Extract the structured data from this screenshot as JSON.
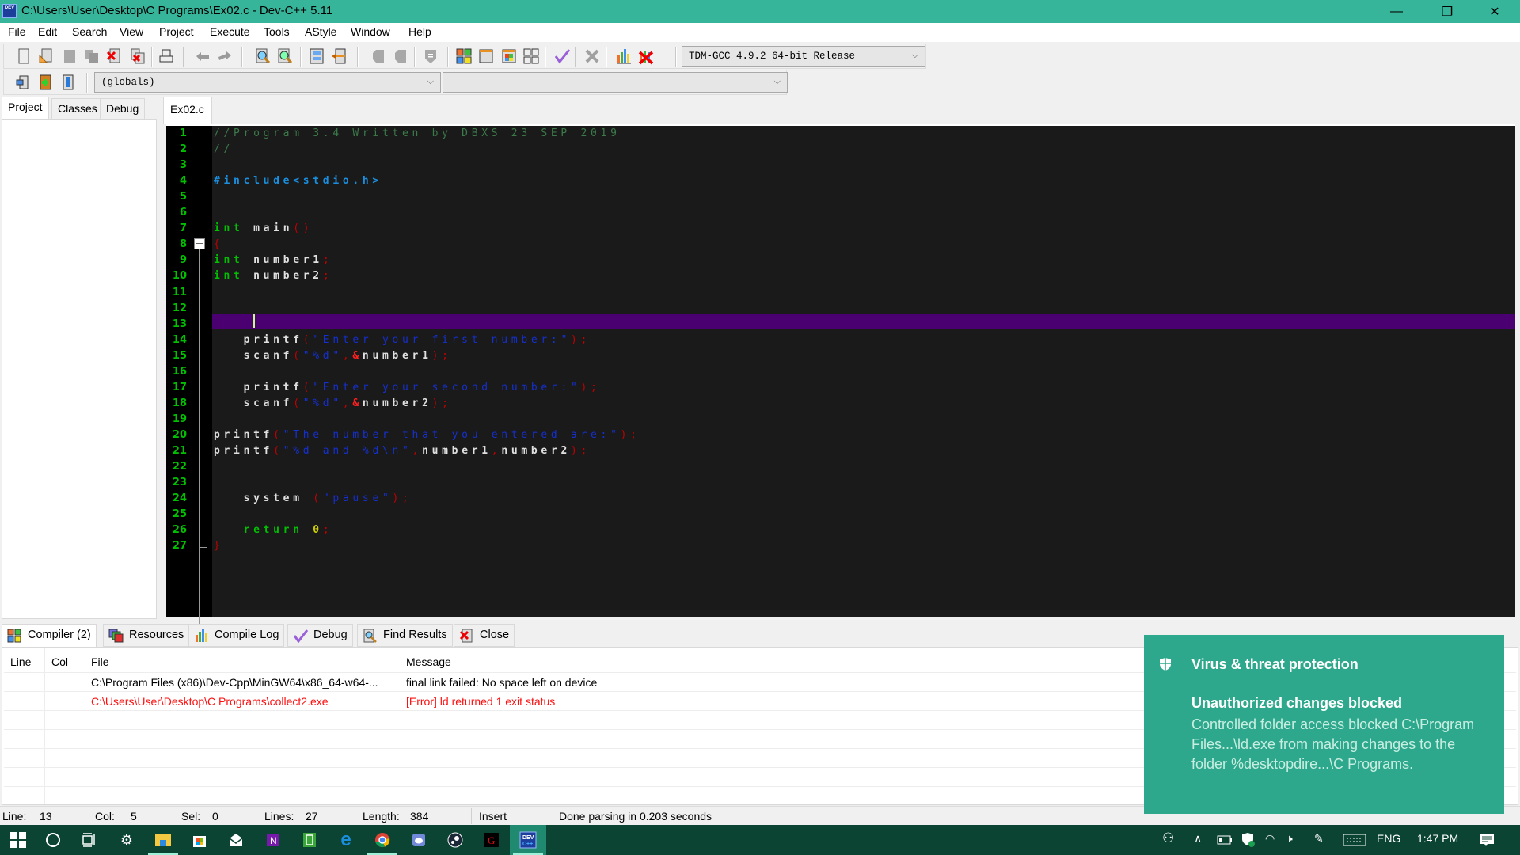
{
  "window": {
    "title": "C:\\Users\\User\\Desktop\\C Programs\\Ex02.c - Dev-C++ 5.11",
    "app_icon_label": "DEV",
    "minimize": "—",
    "restore": "❐",
    "close": "✕"
  },
  "menu": [
    "File",
    "Edit",
    "Search",
    "View",
    "Project",
    "Execute",
    "Tools",
    "AStyle",
    "Window",
    "Help"
  ],
  "toolbar": {
    "compiler_select": "TDM-GCC 4.9.2 64-bit Release",
    "scope_select": "(globals)",
    "function_select": "",
    "chevron": "⌵"
  },
  "left_tabs": [
    "Project",
    "Classes",
    "Debug"
  ],
  "editor": {
    "file_tab": "Ex02.c",
    "current_line": 13,
    "lines": [
      {
        "n": "1",
        "tokens": [
          {
            "t": "//Program 3.4 Written by DBXS 23 SEP 2019",
            "c": "com"
          }
        ]
      },
      {
        "n": "2",
        "tokens": [
          {
            "t": "//",
            "c": "com"
          }
        ]
      },
      {
        "n": "3",
        "tokens": []
      },
      {
        "n": "4",
        "tokens": [
          {
            "t": "#include<stdio.h>",
            "c": "pre"
          }
        ]
      },
      {
        "n": "5",
        "tokens": []
      },
      {
        "n": "6",
        "tokens": []
      },
      {
        "n": "7",
        "tokens": [
          {
            "t": "int",
            "c": "kw"
          },
          {
            "t": " main",
            "c": "id"
          },
          {
            "t": "()",
            "c": "sym"
          }
        ]
      },
      {
        "n": "8",
        "tokens": [
          {
            "t": "{",
            "c": "sym"
          }
        ]
      },
      {
        "n": "9",
        "tokens": [
          {
            "t": "int",
            "c": "kw"
          },
          {
            "t": " number1",
            "c": "id"
          },
          {
            "t": ";",
            "c": "sym"
          }
        ]
      },
      {
        "n": "10",
        "tokens": [
          {
            "t": "int",
            "c": "kw"
          },
          {
            "t": " number2",
            "c": "id"
          },
          {
            "t": ";",
            "c": "sym"
          }
        ]
      },
      {
        "n": "11",
        "tokens": []
      },
      {
        "n": "12",
        "tokens": []
      },
      {
        "n": "13",
        "tokens": []
      },
      {
        "n": "14",
        "tokens": [
          {
            "t": "   printf",
            "c": "id"
          },
          {
            "t": "(",
            "c": "sym"
          },
          {
            "t": "\"Enter your first number:\"",
            "c": "str"
          },
          {
            "t": ");",
            "c": "sym"
          }
        ]
      },
      {
        "n": "15",
        "tokens": [
          {
            "t": "   scanf",
            "c": "id"
          },
          {
            "t": "(",
            "c": "sym"
          },
          {
            "t": "\"%d\"",
            "c": "str"
          },
          {
            "t": ",",
            "c": "sym"
          },
          {
            "t": "&",
            "c": "amp"
          },
          {
            "t": "number1",
            "c": "id"
          },
          {
            "t": ");",
            "c": "sym"
          }
        ]
      },
      {
        "n": "16",
        "tokens": []
      },
      {
        "n": "17",
        "tokens": [
          {
            "t": "   printf",
            "c": "id"
          },
          {
            "t": "(",
            "c": "sym"
          },
          {
            "t": "\"Enter your second number:\"",
            "c": "str"
          },
          {
            "t": ");",
            "c": "sym"
          }
        ]
      },
      {
        "n": "18",
        "tokens": [
          {
            "t": "   scanf",
            "c": "id"
          },
          {
            "t": "(",
            "c": "sym"
          },
          {
            "t": "\"%d\"",
            "c": "str"
          },
          {
            "t": ",",
            "c": "sym"
          },
          {
            "t": "&",
            "c": "amp"
          },
          {
            "t": "number2",
            "c": "id"
          },
          {
            "t": ");",
            "c": "sym"
          }
        ]
      },
      {
        "n": "19",
        "tokens": []
      },
      {
        "n": "20",
        "tokens": [
          {
            "t": "printf",
            "c": "id"
          },
          {
            "t": "(",
            "c": "sym"
          },
          {
            "t": "\"The number that you entered are:\"",
            "c": "str"
          },
          {
            "t": ");",
            "c": "sym"
          }
        ]
      },
      {
        "n": "21",
        "tokens": [
          {
            "t": "printf",
            "c": "id"
          },
          {
            "t": "(",
            "c": "sym"
          },
          {
            "t": "\"%d and %d\\n\"",
            "c": "str"
          },
          {
            "t": ",",
            "c": "sym"
          },
          {
            "t": "number1",
            "c": "id"
          },
          {
            "t": ",",
            "c": "sym"
          },
          {
            "t": "number2",
            "c": "id"
          },
          {
            "t": ");",
            "c": "sym"
          }
        ]
      },
      {
        "n": "22",
        "tokens": []
      },
      {
        "n": "23",
        "tokens": []
      },
      {
        "n": "24",
        "tokens": [
          {
            "t": "   system ",
            "c": "id"
          },
          {
            "t": "(",
            "c": "sym"
          },
          {
            "t": "\"pause\"",
            "c": "str"
          },
          {
            "t": ");",
            "c": "sym"
          }
        ]
      },
      {
        "n": "25",
        "tokens": []
      },
      {
        "n": "26",
        "tokens": [
          {
            "t": "   return ",
            "c": "kw"
          },
          {
            "t": "0",
            "c": "num"
          },
          {
            "t": ";",
            "c": "sym"
          }
        ]
      },
      {
        "n": "27",
        "tokens": [
          {
            "t": "}",
            "c": "sym"
          }
        ]
      }
    ]
  },
  "bottom_tabs": [
    {
      "label": "Compiler (2)",
      "icon": "compiler-icon"
    },
    {
      "label": "Resources",
      "icon": "resources-icon"
    },
    {
      "label": "Compile Log",
      "icon": "compile-log-icon"
    },
    {
      "label": "Debug",
      "icon": "debug-check-icon"
    },
    {
      "label": "Find Results",
      "icon": "find-results-icon"
    },
    {
      "label": "Close",
      "icon": "close-panel-icon"
    }
  ],
  "messages": {
    "columns": [
      "Line",
      "Col",
      "File",
      "Message"
    ],
    "rows": [
      {
        "line": "",
        "col": "",
        "file": "C:\\Program Files (x86)\\Dev-Cpp\\MinGW64\\x86_64-w64-...",
        "message": "final link failed: No space left on device",
        "error": false
      },
      {
        "line": "",
        "col": "",
        "file": "C:\\Users\\User\\Desktop\\C Programs\\collect2.exe",
        "message": "[Error] ld returned 1 exit status",
        "error": true
      }
    ]
  },
  "status": {
    "line_label": "Line:",
    "line": "13",
    "col_label": "Col:",
    "col": "5",
    "sel_label": "Sel:",
    "sel": "0",
    "lines_label": "Lines:",
    "lines": "27",
    "length_label": "Length:",
    "length": "384",
    "mode": "Insert",
    "message": "Done parsing in 0.203 seconds"
  },
  "toast": {
    "title": "Virus & threat protection",
    "heading": "Unauthorized changes blocked",
    "body": "Controlled folder access blocked C:\\Program Files...\\ld.exe from making changes to the folder %desktopdire...\\C Programs."
  },
  "taskbar": {
    "apps": [
      "windows-start",
      "cortana",
      "task-view",
      "settings",
      "file-explorer",
      "store",
      "mail",
      "onenote",
      "notes",
      "edge",
      "chrome",
      "discord",
      "steam",
      "garena",
      "dev-cpp"
    ],
    "language": "ENG",
    "time": "1:47 PM"
  },
  "colors": {
    "titlebar": "#36b59a",
    "editor_bg": "#1a1a1a",
    "current_line": "#4b0072",
    "error_text": "#ff0000",
    "taskbar": "#0c4433",
    "toast": "#2ea88c"
  }
}
